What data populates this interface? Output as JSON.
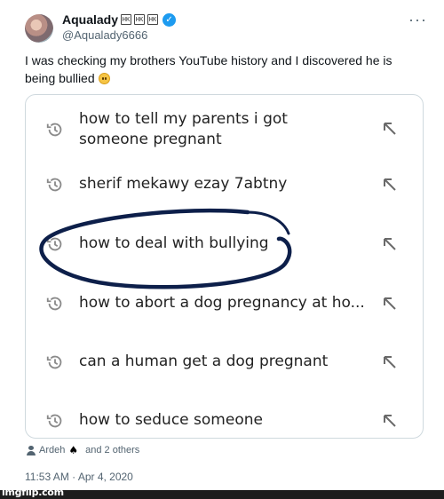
{
  "author": {
    "display_name": "Aqualady",
    "flag_glyphs": [
      "HK",
      "HK",
      "HK"
    ],
    "handle": "@Aqualady6666",
    "verified": true
  },
  "tweet": {
    "text": "I was checking my brothers YouTube history and I discovered he is being bullied",
    "emoji": "pleading-face-emoji"
  },
  "search_history": [
    {
      "line1": "how to tell my parents i got",
      "line2": "someone pregnant"
    },
    {
      "line1": "sherif mekawy ezay 7abtny",
      "line2": ""
    },
    {
      "line1": "how to deal with bullying",
      "line2": "",
      "circled": true
    },
    {
      "line1": "how to abort a dog pregnancy at ho...",
      "line2": ""
    },
    {
      "line1": "can a human get a dog pregnant",
      "line2": ""
    },
    {
      "line1": "how to seduce someone",
      "line2": ""
    }
  ],
  "likes": {
    "name": "Ardeh",
    "suffix_glyph": "♠",
    "others": "and 2 others"
  },
  "timestamp": "11:53 AM · Apr 4, 2020",
  "watermark": "imgflip.com",
  "colors": {
    "verified_blue": "#1d9bf0",
    "secondary_text": "#536471",
    "circle_ink": "#0d1f4a"
  },
  "icons": {
    "history": "history-clock-icon",
    "fill_query": "arrow-up-left-icon",
    "more": "more-dots-icon"
  }
}
